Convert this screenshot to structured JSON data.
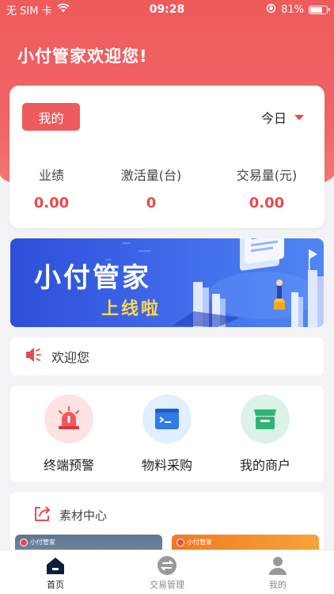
{
  "status_bar": {
    "carrier": "无 SIM 卡",
    "time": "09:28",
    "battery": "81%",
    "battery_level": 0.81
  },
  "header": {
    "welcome": "小付管家欢迎您!"
  },
  "stats": {
    "mine_label": "我的",
    "period_label": "今日",
    "items": [
      {
        "label": "业绩",
        "value": "0.00"
      },
      {
        "label": "激活量(台)",
        "value": "0"
      },
      {
        "label": "交易量(元)",
        "value": "0.00"
      }
    ]
  },
  "banner": {
    "title": "小付管家",
    "subtitle": "上线啦"
  },
  "notice": {
    "text": "欢迎您"
  },
  "quick_actions": [
    {
      "label": "终端预警",
      "icon": "alarm-light-icon"
    },
    {
      "label": "物料采购",
      "icon": "terminal-window-icon"
    },
    {
      "label": "我的商户",
      "icon": "store-icon"
    }
  ],
  "material": {
    "title": "素材中心",
    "thumb_tag": "小付管家"
  },
  "tabbar": {
    "items": [
      {
        "label": "首页",
        "icon": "home-icon",
        "active": true
      },
      {
        "label": "交易管理",
        "icon": "exchange-icon",
        "active": false
      },
      {
        "label": "我的",
        "icon": "user-icon",
        "active": false
      }
    ]
  },
  "colors": {
    "brand_red": "#ed5b5d",
    "value_red": "#e84a4d",
    "banner_blue": "#3d66e8",
    "accent_yellow": "#ffd84a"
  }
}
